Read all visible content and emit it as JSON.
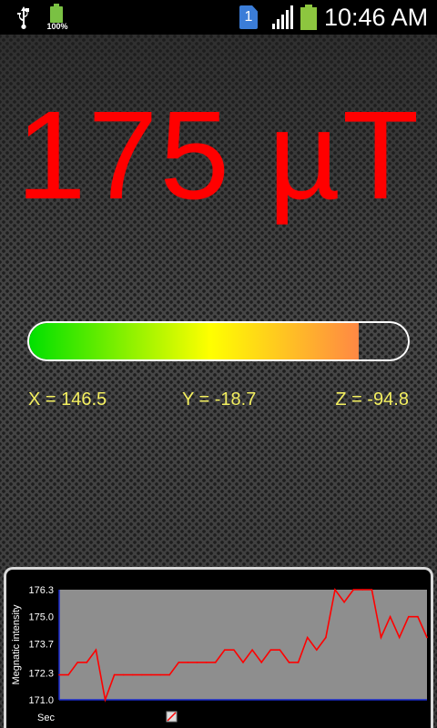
{
  "status_bar": {
    "battery_small_percent": "100%",
    "sim_slot": "1",
    "time": "10:46 AM",
    "icons": [
      "usb-icon",
      "battery-percent-icon",
      "sim-card-icon",
      "signal-icon",
      "battery-icon"
    ]
  },
  "reading": {
    "value": "175 µT"
  },
  "meter": {
    "fraction": 0.87,
    "colors": [
      "#00e000",
      "#ffff00",
      "#ff8844"
    ]
  },
  "axes": {
    "x": "X = 146.5",
    "y": "Y = -18.7",
    "z": "Z = -94.8",
    "color": "#f4f060"
  },
  "chart_data": {
    "type": "line",
    "title": "",
    "ylabel": "Megnatic intensity",
    "xlabel": "Sec",
    "y_ticks": [
      "176.3",
      "175.0",
      "173.7",
      "172.3",
      "171.0"
    ],
    "ylim": [
      171.0,
      176.3
    ],
    "line_color": "#ff0000",
    "plot_bg": "#8e8e8e",
    "axis_color": "#1a2bd0",
    "series": [
      {
        "x": [
          0,
          1,
          2,
          3,
          4,
          5,
          6,
          7,
          8,
          9,
          10,
          11,
          12,
          13,
          14,
          15,
          16,
          17,
          18,
          19,
          20,
          21,
          22,
          23,
          24,
          25,
          26,
          27,
          28,
          29,
          30,
          31,
          32,
          33,
          34,
          35,
          36,
          37,
          38,
          39,
          40
        ],
        "values": [
          172.2,
          172.2,
          172.8,
          172.8,
          173.4,
          171.0,
          172.2,
          172.2,
          172.2,
          172.2,
          172.2,
          172.2,
          172.2,
          172.8,
          172.8,
          172.8,
          172.8,
          172.8,
          173.4,
          173.4,
          172.8,
          173.4,
          172.8,
          173.4,
          173.4,
          172.8,
          172.8,
          174.0,
          173.4,
          174.0,
          176.3,
          175.7,
          176.3,
          176.3,
          176.3,
          174.0,
          175.0,
          174.0,
          175.0,
          175.0,
          174.0
        ]
      }
    ]
  }
}
